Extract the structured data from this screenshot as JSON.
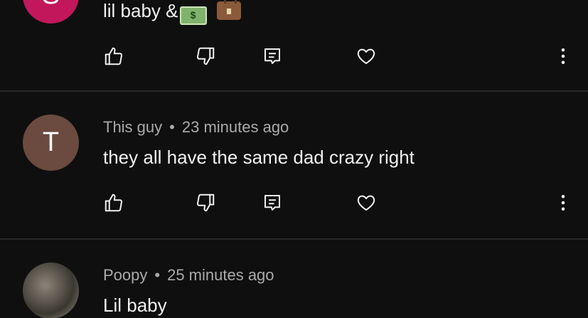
{
  "comments": [
    {
      "avatar_letter": "S",
      "avatar_color": "#c2185b",
      "author": "",
      "time": "",
      "text": "lil baby &"
    },
    {
      "avatar_letter": "T",
      "avatar_color": "#6b4a3f",
      "author": "This guy",
      "time": "23 minutes ago",
      "text": "they all have the same dad crazy right"
    },
    {
      "avatar_letter": "",
      "avatar_color": "#5d584f",
      "author": "Poopy",
      "time": "25 minutes ago",
      "text": "Lil baby"
    }
  ],
  "separator": "•",
  "icons": [
    "thumbs-up-icon",
    "thumbs-down-icon",
    "reply-icon",
    "heart-icon",
    "more-vertical-icon"
  ],
  "emoji": {
    "money": "$",
    "briefcase": "briefcase"
  }
}
